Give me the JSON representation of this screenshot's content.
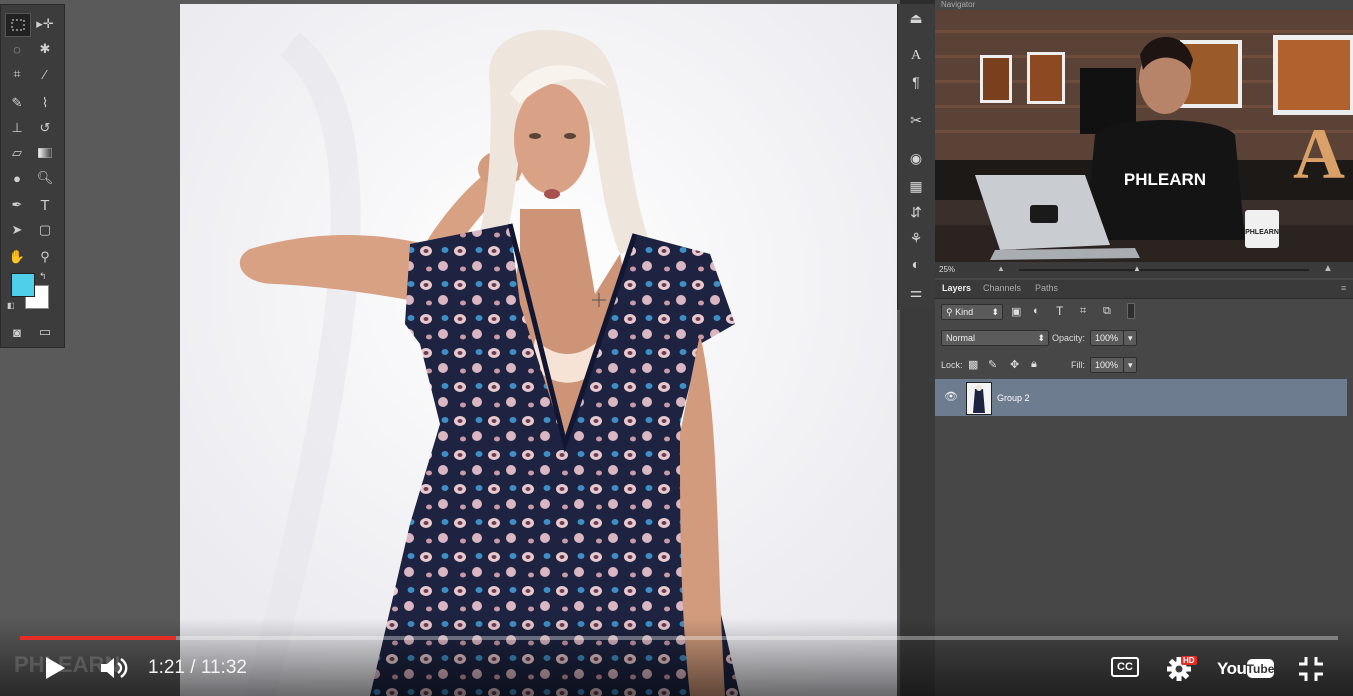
{
  "photoshop": {
    "navigator": {
      "title": "Navigator",
      "zoom": "25%",
      "video_shirt_text": "PHLEARN",
      "video_mug_text": "PHLEARN",
      "marquee_letter": "A"
    },
    "layers_panel": {
      "tabs": [
        "Layers",
        "Channels",
        "Paths"
      ],
      "kind_filter": "Kind",
      "blend_mode": "Normal",
      "opacity_label": "Opacity:",
      "opacity_value": "100%",
      "lock_label": "Lock:",
      "fill_label": "Fill:",
      "fill_value": "100%",
      "layers": [
        {
          "name": "Group 2",
          "visible": true,
          "selected": true
        }
      ]
    },
    "toolbar": {
      "foreground_color": "#4fd0ea",
      "background_color": "#ffffff",
      "text_tool_glyph": "T"
    },
    "icon_strip": {
      "character_glyph": "A",
      "paragraph_glyph": "¶"
    }
  },
  "player": {
    "current_time": "1:21",
    "separator": " / ",
    "duration": "11:32",
    "progress_fraction": 0.118,
    "accent_color": "#e52d27",
    "cc_label": "CC",
    "hd_badge": "HD",
    "youtube_logo": "YouTube",
    "watermark": "PHLEARN"
  }
}
